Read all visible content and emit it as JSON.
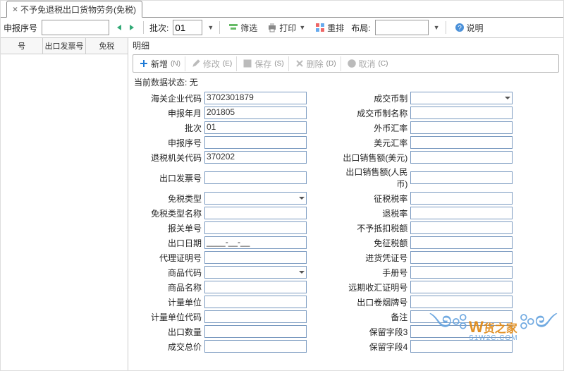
{
  "tab": {
    "title": "不予免退税出口货物劳务(免税)"
  },
  "toolbar": {
    "seq_label": "申报序号",
    "batch_label": "批次:",
    "batch_value": "01",
    "filter": "筛选",
    "print": "打印",
    "rearrange": "重排",
    "layout": "布局:",
    "layout_value": "",
    "help": "说明"
  },
  "grid": {
    "col_seq": "号",
    "col_invoice": "出口发票号",
    "col_type": "免税"
  },
  "detail": {
    "title": "明细",
    "add": "新增",
    "add_sfx": "(N)",
    "edit": "修改",
    "edit_sfx": "(E)",
    "save": "保存",
    "save_sfx": "(S)",
    "del": "删除",
    "del_sfx": "(D)",
    "cancel": "取消",
    "cancel_sfx": "(C)",
    "status_label": "当前数据状态:",
    "status_value": "无"
  },
  "form": {
    "l": {
      "customs_code": {
        "label": "海关企业代码",
        "value": "3702301879"
      },
      "declare_ym": {
        "label": "申报年月",
        "value": "201805"
      },
      "batch": {
        "label": "批次",
        "value": "01"
      },
      "declare_seq": {
        "label": "申报序号",
        "value": ""
      },
      "tax_office": {
        "label": "退税机关代码",
        "value": "370202"
      },
      "export_invoice": {
        "label": "出口发票号",
        "value": ""
      },
      "exempt_type": {
        "label": "免税类型",
        "value": ""
      },
      "exempt_name": {
        "label": "免税类型名称",
        "value": ""
      },
      "customs_decl": {
        "label": "报关单号",
        "value": ""
      },
      "export_date": {
        "label": "出口日期",
        "value": "____-__-__"
      },
      "agent_cert": {
        "label": "代理证明号",
        "value": ""
      },
      "goods_code": {
        "label": "商品代码",
        "value": ""
      },
      "goods_name": {
        "label": "商品名称",
        "value": ""
      },
      "unit": {
        "label": "计量单位",
        "value": ""
      },
      "unit_code": {
        "label": "计量单位代码",
        "value": ""
      },
      "export_qty": {
        "label": "出口数量",
        "value": ""
      },
      "total_price": {
        "label": "成交总价",
        "value": ""
      }
    },
    "r": {
      "currency": {
        "label": "成交币制",
        "value": ""
      },
      "currency_name": {
        "label": "成交币制名称",
        "value": ""
      },
      "fx_rate": {
        "label": "外币汇率",
        "value": ""
      },
      "usd_rate": {
        "label": "美元汇率",
        "value": ""
      },
      "sales_usd": {
        "label": "出口销售额(美元)",
        "value": ""
      },
      "sales_rmb": {
        "label": "出口销售额(人民币)",
        "value": ""
      },
      "levy_rate": {
        "label": "征税税率",
        "value": ""
      },
      "refund_rate": {
        "label": "退税率",
        "value": ""
      },
      "no_deduct": {
        "label": "不予抵扣税额",
        "value": ""
      },
      "exempt_amt": {
        "label": "免征税额",
        "value": ""
      },
      "purchase_cert": {
        "label": "进货凭证号",
        "value": ""
      },
      "manual_no": {
        "label": "手册号",
        "value": ""
      },
      "forward_cert": {
        "label": "远期收汇证明号",
        "value": ""
      },
      "cigarette_no": {
        "label": "出口卷烟牌号",
        "value": ""
      },
      "remark": {
        "label": "备注",
        "value": ""
      },
      "reserve3": {
        "label": "保留字段3",
        "value": ""
      },
      "reserve4": {
        "label": "保留字段4",
        "value": ""
      }
    }
  },
  "watermark": {
    "brand": "货之家",
    "url": "S1W2C.COM",
    "w_char": "W"
  }
}
